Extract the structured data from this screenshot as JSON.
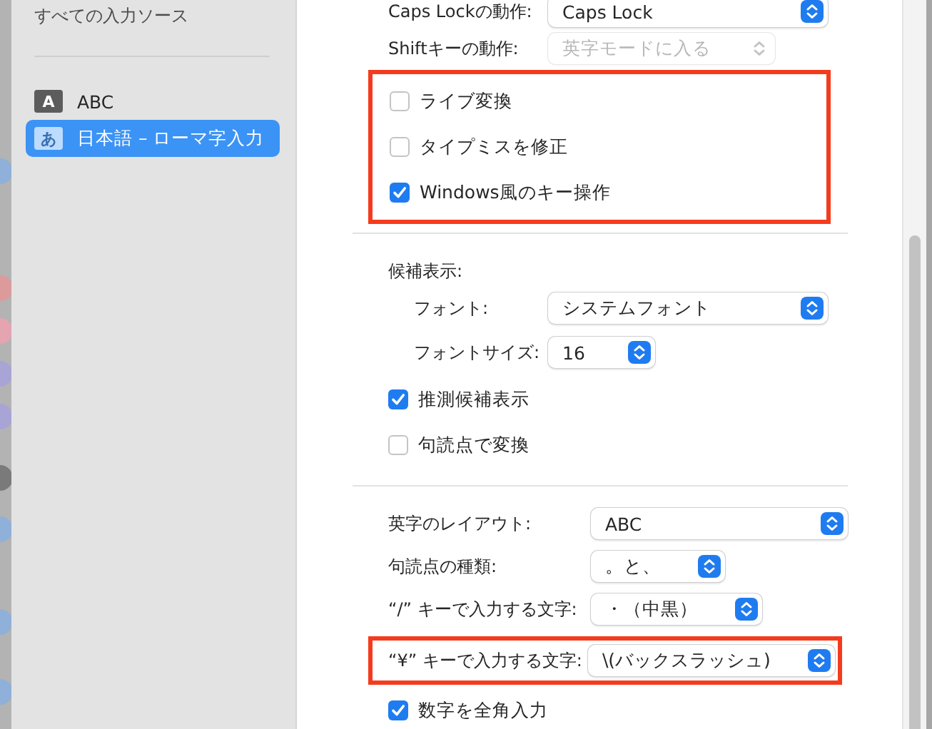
{
  "sidebar": {
    "header": "すべての入力ソース",
    "items": [
      {
        "badge": "A",
        "label": "ABC",
        "selected": false
      },
      {
        "badge": "あ",
        "label": "日本語 – ローマ字入力",
        "selected": true
      }
    ]
  },
  "sections": [
    {
      "rows": [
        {
          "kind": "select",
          "label": "Caps Lockの動作:",
          "value": "Caps Lock",
          "wide": true,
          "disabled": false
        },
        {
          "kind": "select",
          "label": "Shiftキーの動作:",
          "value": "英字モードに入る",
          "wide": false,
          "disabled": true
        },
        {
          "kind": "group",
          "highlighted": true,
          "rows": [
            {
              "kind": "checkbox",
              "label": "ライブ変換",
              "checked": false
            },
            {
              "kind": "checkbox",
              "label": "タイプミスを修正",
              "checked": false
            },
            {
              "kind": "checkbox",
              "label": "Windows風のキー操作",
              "checked": true
            }
          ]
        }
      ]
    },
    {
      "rows": [
        {
          "kind": "subgroup",
          "label": "候補表示:",
          "rows": [
            {
              "kind": "select",
              "label": "フォント:",
              "value": "システムフォント",
              "wide": true,
              "disabled": false
            },
            {
              "kind": "select",
              "label": "フォントサイズ:",
              "value": "16",
              "wide": false,
              "disabled": false
            }
          ]
        },
        {
          "kind": "checkbox",
          "label": "推測候補表示",
          "checked": true
        },
        {
          "kind": "checkbox",
          "label": "句読点で変換",
          "checked": false
        }
      ]
    },
    {
      "rows": [
        {
          "kind": "select",
          "label": "英字のレイアウト:",
          "value": "ABC",
          "wide": true,
          "disabled": false
        },
        {
          "kind": "select",
          "label": "句読点の種類:",
          "value": "。と、",
          "wide": false,
          "disabled": false
        },
        {
          "kind": "select",
          "label": "“/” キーで入力する文字:",
          "value": "・（中黒）",
          "wide": false,
          "disabled": false
        },
        {
          "kind": "group",
          "highlighted": true,
          "rows": [
            {
              "kind": "select",
              "label": "“¥” キーで入力する文字:",
              "value": "\\(バックスラッシュ)",
              "wide": false,
              "disabled": false
            }
          ]
        },
        {
          "kind": "checkbox",
          "label": "数字を全角入力",
          "checked": true
        }
      ]
    }
  ]
}
